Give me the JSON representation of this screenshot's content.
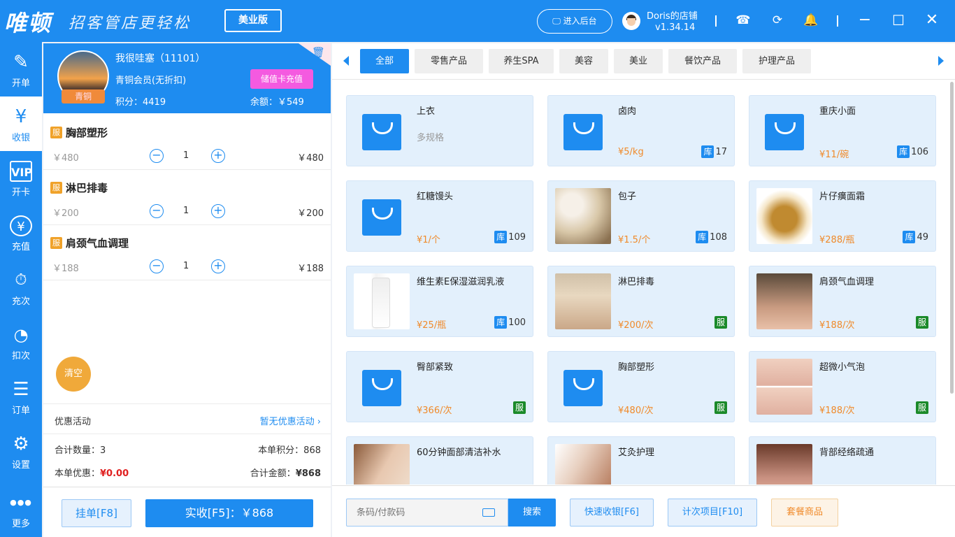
{
  "header": {
    "logo": "唯顿",
    "slogan": "招客管店更轻松",
    "edition": "美业版",
    "backend": "🖵 进入后台",
    "shop_name": "Doris的店铺",
    "version": "v1.34.14"
  },
  "sidebar": {
    "items": [
      {
        "label": "开单",
        "icon": "✎"
      },
      {
        "label": "收银",
        "icon": "¥"
      },
      {
        "label": "开卡",
        "icon": "VIP"
      },
      {
        "label": "充值",
        "icon": "¥"
      },
      {
        "label": "充次",
        "icon": "⏱"
      },
      {
        "label": "扣次",
        "icon": "◔"
      },
      {
        "label": "订单",
        "icon": "☰"
      },
      {
        "label": "设置",
        "icon": "⚙"
      },
      {
        "label": "更多",
        "icon": "●●●"
      }
    ]
  },
  "member": {
    "name": "我很哇塞（11101）",
    "level": "青铜会员(无折扣)",
    "badge": "青铜",
    "points": "积分：4419",
    "recharge": "储值卡充值",
    "balance": "余额：￥549"
  },
  "cart": {
    "items": [
      {
        "tag": "服",
        "name": "胸部塑形",
        "price": "￥480",
        "qty": "1",
        "subtotal": "￥480"
      },
      {
        "tag": "服",
        "name": "淋巴排毒",
        "price": "￥200",
        "qty": "1",
        "subtotal": "￥200"
      },
      {
        "tag": "服",
        "name": "肩颈气血调理",
        "price": "￥188",
        "qty": "1",
        "subtotal": "￥188"
      }
    ],
    "clear": "清空",
    "promo_label": "优惠活动",
    "promo_value": "暂无优惠活动 ›",
    "total_qty_label": "合计数量：",
    "total_qty": "3",
    "points_label": "本单积分：",
    "points": "868",
    "discount_label": "本单优惠：",
    "discount": "¥0.00",
    "total_label": "合计金额：",
    "total": "¥868",
    "hold": "挂单[F8]",
    "pay": "实收[F5]：￥868"
  },
  "categories": [
    "全部",
    "零售产品",
    "养生SPA",
    "美容",
    "美业",
    "餐饮产品",
    "护理产品"
  ],
  "products": [
    {
      "name": "上衣",
      "spec": "多规格",
      "price": "",
      "stock": "",
      "svc": "",
      "img": "bag"
    },
    {
      "name": "卤肉",
      "spec": "",
      "price": "¥5/kg",
      "stock": "17",
      "svc": "",
      "img": "bag"
    },
    {
      "name": "重庆小面",
      "spec": "",
      "price": "¥11/碗",
      "stock": "106",
      "svc": "",
      "img": "bag"
    },
    {
      "name": "红糖馒头",
      "spec": "",
      "price": "¥1/个",
      "stock": "109",
      "svc": "",
      "img": "bag"
    },
    {
      "name": "包子",
      "spec": "",
      "price": "¥1.5/个",
      "stock": "108",
      "svc": "",
      "img": "photo1"
    },
    {
      "name": "片仔癀面霜",
      "spec": "",
      "price": "¥288/瓶",
      "stock": "49",
      "svc": "",
      "img": "photo2"
    },
    {
      "name": "维生素E保湿滋润乳液",
      "spec": "",
      "price": "¥25/瓶",
      "stock": "100",
      "svc": "",
      "img": "photo3"
    },
    {
      "name": "淋巴排毒",
      "spec": "",
      "price": "¥200/次",
      "stock": "",
      "svc": "服",
      "img": "photo4"
    },
    {
      "name": "肩颈气血调理",
      "spec": "",
      "price": "¥188/次",
      "stock": "",
      "svc": "服",
      "img": "photo5"
    },
    {
      "name": "臀部紧致",
      "spec": "",
      "price": "¥366/次",
      "stock": "",
      "svc": "服",
      "img": "bag"
    },
    {
      "name": "胸部塑形",
      "spec": "",
      "price": "¥480/次",
      "stock": "",
      "svc": "服",
      "img": "bag"
    },
    {
      "name": "超微小气泡",
      "spec": "",
      "price": "¥188/次",
      "stock": "",
      "svc": "服",
      "img": "photo6"
    },
    {
      "name": "60分钟面部清洁补水",
      "spec": "",
      "price": "",
      "stock": "",
      "svc": "",
      "img": "photo7"
    },
    {
      "name": "艾灸护理",
      "spec": "",
      "price": "",
      "stock": "",
      "svc": "",
      "img": "photo8"
    },
    {
      "name": "背部经络疏通",
      "spec": "",
      "price": "",
      "stock": "",
      "svc": "",
      "img": "photo9"
    }
  ],
  "stock_tag": "库",
  "bottom": {
    "search_placeholder": "条码/付款码",
    "search": "搜索",
    "quick": "快速收银[F6]",
    "count": "计次项目[F10]",
    "package": "套餐商品"
  }
}
